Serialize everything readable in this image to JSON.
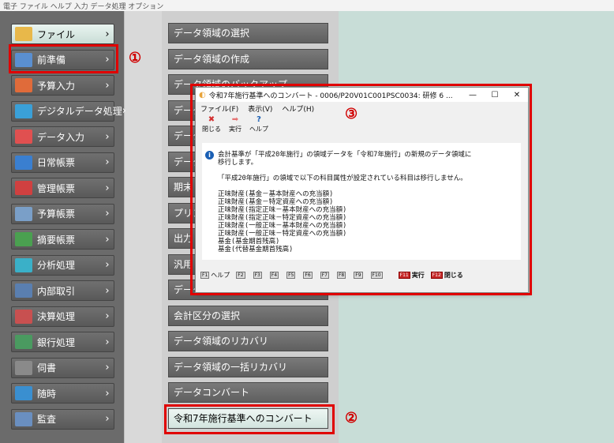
{
  "top_strip_text": "電子 ファイル ヘルプ 入力 データ処理 オプション",
  "left_menu": [
    {
      "label": "ファイル",
      "icon": "folder-icon",
      "color": "#e8b84a"
    },
    {
      "label": "前準備",
      "icon": "document-list-icon",
      "color": "#5a8fd0"
    },
    {
      "label": "予算入力",
      "icon": "pen-icon",
      "color": "#e06b3a"
    },
    {
      "label": "デジタルデータ処理",
      "icon": "globe-icon",
      "color": "#3aa0d8"
    },
    {
      "label": "データ入力",
      "icon": "pencil-icon",
      "color": "#e05050"
    },
    {
      "label": "日常帳票",
      "icon": "books-icon",
      "color": "#3a7fd0"
    },
    {
      "label": "管理帳票",
      "icon": "books-red-icon",
      "color": "#d04040"
    },
    {
      "label": "予算帳票",
      "icon": "printer-icon",
      "color": "#7a9fc8"
    },
    {
      "label": "摘要帳票",
      "icon": "books-green-icon",
      "color": "#4aa050"
    },
    {
      "label": "分析処理",
      "icon": "pie-chart-icon",
      "color": "#3ab0c8"
    },
    {
      "label": "内部取引",
      "icon": "people-icon",
      "color": "#5a7fb0"
    },
    {
      "label": "決算処理",
      "icon": "ledger-icon",
      "color": "#c85050"
    },
    {
      "label": "銀行処理",
      "icon": "bank-icon",
      "color": "#4a9a60"
    },
    {
      "label": "伺書",
      "icon": "memo-icon",
      "color": "#8a8a8a"
    },
    {
      "label": "随時",
      "icon": "clock-icon",
      "color": "#3a8fd0"
    },
    {
      "label": "監査",
      "icon": "magnifier-icon",
      "color": "#6a8fc0"
    }
  ],
  "sub_menu": [
    "データ領域の選択",
    "データ領域の作成",
    "データ領域のバックアップ",
    "データ",
    "データ",
    "データ",
    "期末",
    "プリン",
    "出力",
    "汎用",
    "データ",
    "会計区分の選択",
    "データ領域のリカバリ",
    "データ領域の一括リカバリ",
    "データコンバート",
    "令和7年施行基準へのコンバート"
  ],
  "markers": {
    "one": "①",
    "two": "②",
    "three": "③"
  },
  "dialog": {
    "title": "令和7年施行基準へのコンバート - 0006/P20V01C001PSC0034: 研修 6 ...",
    "window_buttons": {
      "minimize": "—",
      "maximize": "☐",
      "close": "✕"
    },
    "menus": [
      "ファイル(F)",
      "表示(V)",
      "ヘルプ(H)"
    ],
    "toolbar": [
      {
        "label": "閉じる",
        "icon": "close-x-icon",
        "glyph": "✖",
        "color": "#d32f2f"
      },
      {
        "label": "実行",
        "icon": "arrow-right-icon",
        "glyph": "➡",
        "color": "#e57373"
      },
      {
        "label": "ヘルプ",
        "icon": "help-icon",
        "glyph": "?",
        "color": "#1a5fb4"
      }
    ],
    "message": "会計基準が「平成20年施行」の領域データを「令和7年施行」の新規のデータ領域に\n移行します。\n\n「平成20年施行」の領域で以下の科目属性が設定されている科目は移行しません。\n\n正味財産(基金－基本財産への充当額)\n正味財産(基金－特定資産への充当額)\n正味財産(指定正味－基本財産への充当額)\n正味財産(指定正味－特定資産への充当額)\n正味財産(一般正味－基本財産への充当額)\n正味財産(一般正味－特定資産への充当額)\n基金(基金期首残高)\n基金(代替基金期首残高)",
    "fkeys": [
      {
        "key": "F1",
        "label": "ヘルプ"
      },
      {
        "key": "F2",
        "label": ""
      },
      {
        "key": "F3",
        "label": ""
      },
      {
        "key": "F4",
        "label": ""
      },
      {
        "key": "F5",
        "label": ""
      },
      {
        "key": "F6",
        "label": ""
      },
      {
        "key": "F7",
        "label": ""
      },
      {
        "key": "F8",
        "label": ""
      },
      {
        "key": "F9",
        "label": ""
      },
      {
        "key": "F10",
        "label": ""
      },
      {
        "key": "F11",
        "label": "実行"
      },
      {
        "key": "F12",
        "label": "閉じる"
      }
    ]
  }
}
